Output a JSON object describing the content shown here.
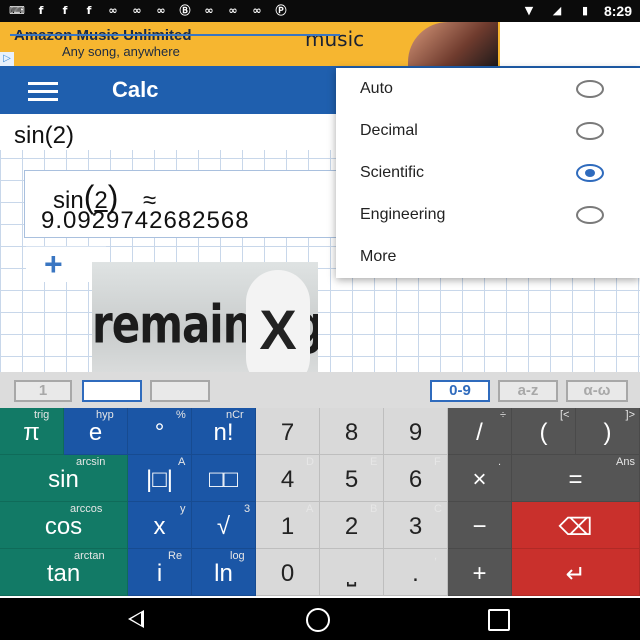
{
  "status_bar": {
    "time": "8:29",
    "icons": [
      "keyboard-icon",
      "facebook-icon",
      "facebook-icon",
      "facebook-icon",
      "link-icon",
      "link-icon",
      "link-icon",
      "b-icon",
      "link-icon",
      "link-icon",
      "link-icon",
      "pinterest-icon",
      "wifi-icon",
      "signal-icon",
      "battery-icon"
    ]
  },
  "ad": {
    "title": "Amazon Music Unlimited",
    "subtitle": "Any song, anywhere",
    "brand": "music",
    "badge": "▷"
  },
  "app_bar": {
    "title": "Calc"
  },
  "editor": {
    "input": "sin(2)",
    "expr_fn": "sin",
    "expr_open": "(",
    "expr_arg": "2",
    "expr_close": ")",
    "expr_approx": "≈",
    "result": "9.0929742682568"
  },
  "add_button": "+",
  "dropdown": {
    "items": [
      {
        "label": "Auto",
        "selected": false
      },
      {
        "label": "Decimal",
        "selected": false
      },
      {
        "label": "Scientific",
        "selected": true
      },
      {
        "label": "Engineering",
        "selected": false
      },
      {
        "label": "More"
      }
    ]
  },
  "overlay": {
    "text": "remaining",
    "close": "X"
  },
  "keyboard_tabs": [
    "1",
    "",
    "",
    "0-9",
    "a-z",
    "α-ω"
  ],
  "keys": {
    "row1": [
      {
        "main": "π",
        "sub": "trig"
      },
      {
        "main": "e",
        "sub": "hyp"
      },
      {
        "main": "°",
        "sub": "%"
      },
      {
        "main": "n!",
        "sub": "nCr"
      },
      {
        "main": "7",
        "sub": ""
      },
      {
        "main": "8",
        "sub": ""
      },
      {
        "main": "9",
        "sub": ""
      },
      {
        "main": "/",
        "sub": "÷"
      },
      {
        "main": "(",
        "sub": "[<"
      },
      {
        "main": ")",
        "sub": "]>"
      }
    ],
    "row2": [
      {
        "main": "sin",
        "sub": "arcsin"
      },
      {
        "main": "|□|",
        "sub": "A"
      },
      {
        "main": "□□",
        "sub": ""
      },
      {
        "main": "4",
        "sub": "D"
      },
      {
        "main": "5",
        "sub": "E"
      },
      {
        "main": "6",
        "sub": "F"
      },
      {
        "main": "×",
        "sub": "."
      },
      {
        "main": "=",
        "sub": "Ans"
      }
    ],
    "row3": [
      {
        "main": "cos",
        "sub": "arccos"
      },
      {
        "main": "x",
        "sub": "y"
      },
      {
        "main": "√",
        "sub": "3"
      },
      {
        "main": "1",
        "sub": "A"
      },
      {
        "main": "2",
        "sub": "B"
      },
      {
        "main": "3",
        "sub": "C"
      },
      {
        "main": "−",
        "sub": ""
      },
      {
        "main": "⌫",
        "sub": ""
      }
    ],
    "row4": [
      {
        "main": "tan",
        "sub": "arctan"
      },
      {
        "main": "i",
        "sub": "Re"
      },
      {
        "main": "ln",
        "sub": "log"
      },
      {
        "main": "0",
        "sub": ""
      },
      {
        "main": "⎵",
        "sub": ""
      },
      {
        "main": ".",
        "sub": ","
      },
      {
        "main": "+",
        "sub": ""
      },
      {
        "main": "↵",
        "sub": ""
      }
    ]
  }
}
